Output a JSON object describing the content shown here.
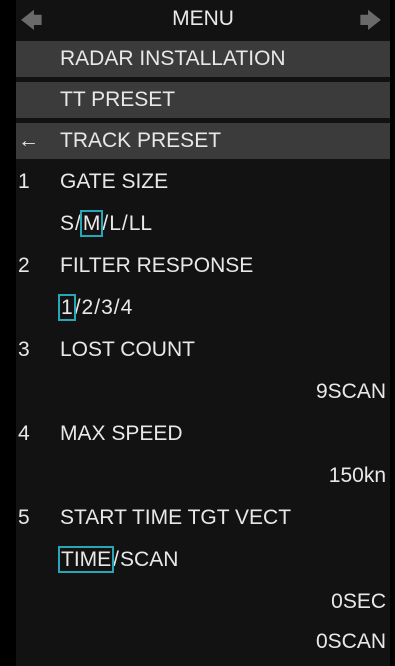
{
  "menu": {
    "title": "MENU",
    "arrow_left": "🡄",
    "arrow_right": "🡆",
    "back_arrow": "←",
    "items": [
      {
        "label": "RADAR INSTALLATION"
      },
      {
        "label": "TT PRESET"
      },
      {
        "label": "TRACK PRESET"
      }
    ],
    "settings": [
      {
        "num": "1",
        "label": "GATE SIZE",
        "options": [
          "S",
          "M",
          "L",
          "LL"
        ],
        "selected": "M"
      },
      {
        "num": "2",
        "label": "FILTER RESPONSE",
        "options": [
          "1",
          "2",
          "3",
          "4"
        ],
        "selected": "1"
      },
      {
        "num": "3",
        "label": "LOST COUNT",
        "value": "9SCAN"
      },
      {
        "num": "4",
        "label": "MAX SPEED",
        "value": "150kn"
      },
      {
        "num": "5",
        "label": "START TIME TGT VECT",
        "options": [
          "TIME",
          "SCAN"
        ],
        "selected": "TIME",
        "values": [
          "0SEC",
          "0SCAN"
        ]
      }
    ]
  },
  "colors": {
    "background": "#121212",
    "item_bar": "#3b3b3b",
    "selection_outline": "#27a6b8",
    "text": "#e8e8e8"
  }
}
